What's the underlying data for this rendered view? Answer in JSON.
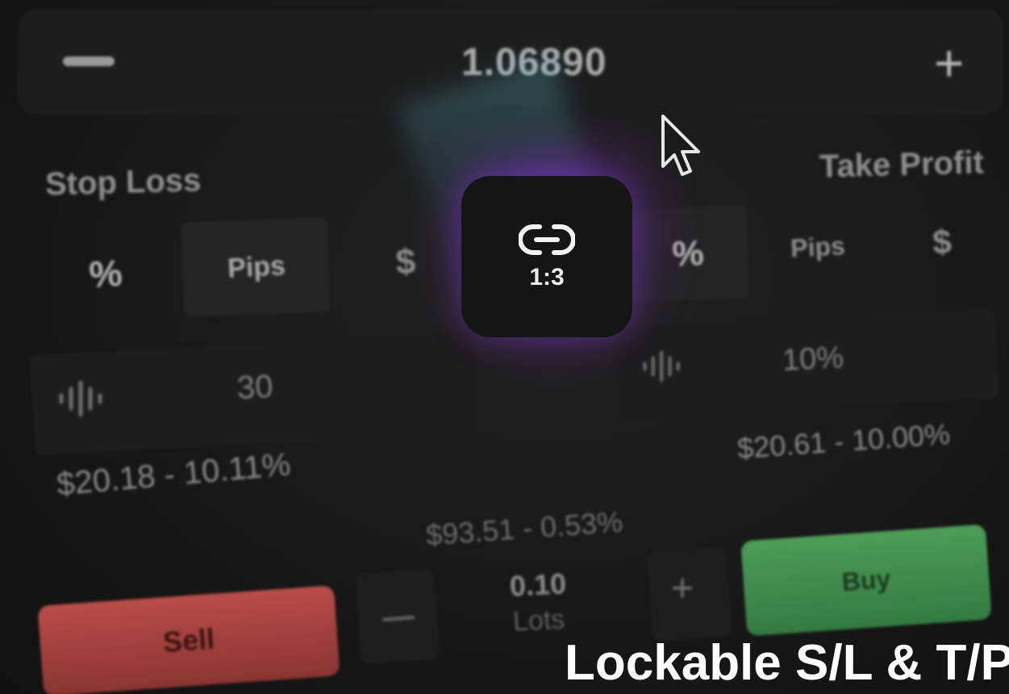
{
  "price_row": {
    "value": "1.06890",
    "decrease_icon": "minus-icon",
    "increase_icon": "plus-icon"
  },
  "stop_loss": {
    "title": "Stop Loss",
    "modes": [
      "%",
      "Pips",
      "$"
    ],
    "selected_mode": "Pips",
    "value": "30",
    "summary": "$20.18 - 10.11%",
    "input_icon": "waveform-icon"
  },
  "take_profit": {
    "title": "Take Profit",
    "modes": [
      "%",
      "Pips",
      "$"
    ],
    "selected_mode": "%",
    "value": "10%",
    "summary": "$20.61 - 10.00%",
    "input_icon": "waveform-icon"
  },
  "link": {
    "ratio": "1:3",
    "icon": "link-icon"
  },
  "margin_summary": "$93.51 - 0.53%",
  "order": {
    "sell_label": "Sell",
    "buy_label": "Buy",
    "lot_value": "0.10",
    "lot_unit": "Lots"
  },
  "caption": "Lockable S/L & T/P",
  "colors": {
    "sell": "#b94d49",
    "buy": "#4d9d58",
    "glow": "#9a40dc",
    "background": "#151515"
  }
}
